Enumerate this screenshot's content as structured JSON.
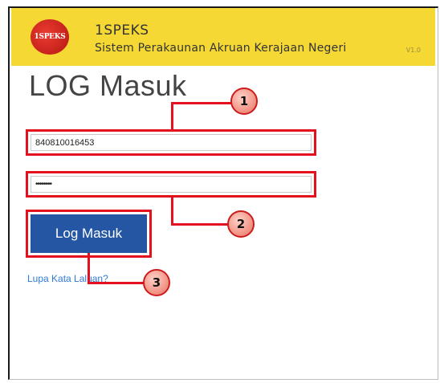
{
  "header": {
    "app_name": "1SPEKS",
    "app_subtitle": "Sistem Perakaunan Akruan Kerajaan Negeri",
    "version": "V1.0",
    "logo_text": "1SPEKS",
    "background_color": "#f6d835"
  },
  "login": {
    "title": "LOG Masuk",
    "username_value": "840810016453",
    "password_value": "••••••••",
    "submit_label": "Log Masuk",
    "forgot_password_label": "Lupa Kata Laluan?"
  },
  "callouts": [
    "1",
    "2",
    "3"
  ],
  "colors": {
    "button": "#2456a3",
    "highlight": "#e3101d",
    "link": "#2f7bd7"
  }
}
